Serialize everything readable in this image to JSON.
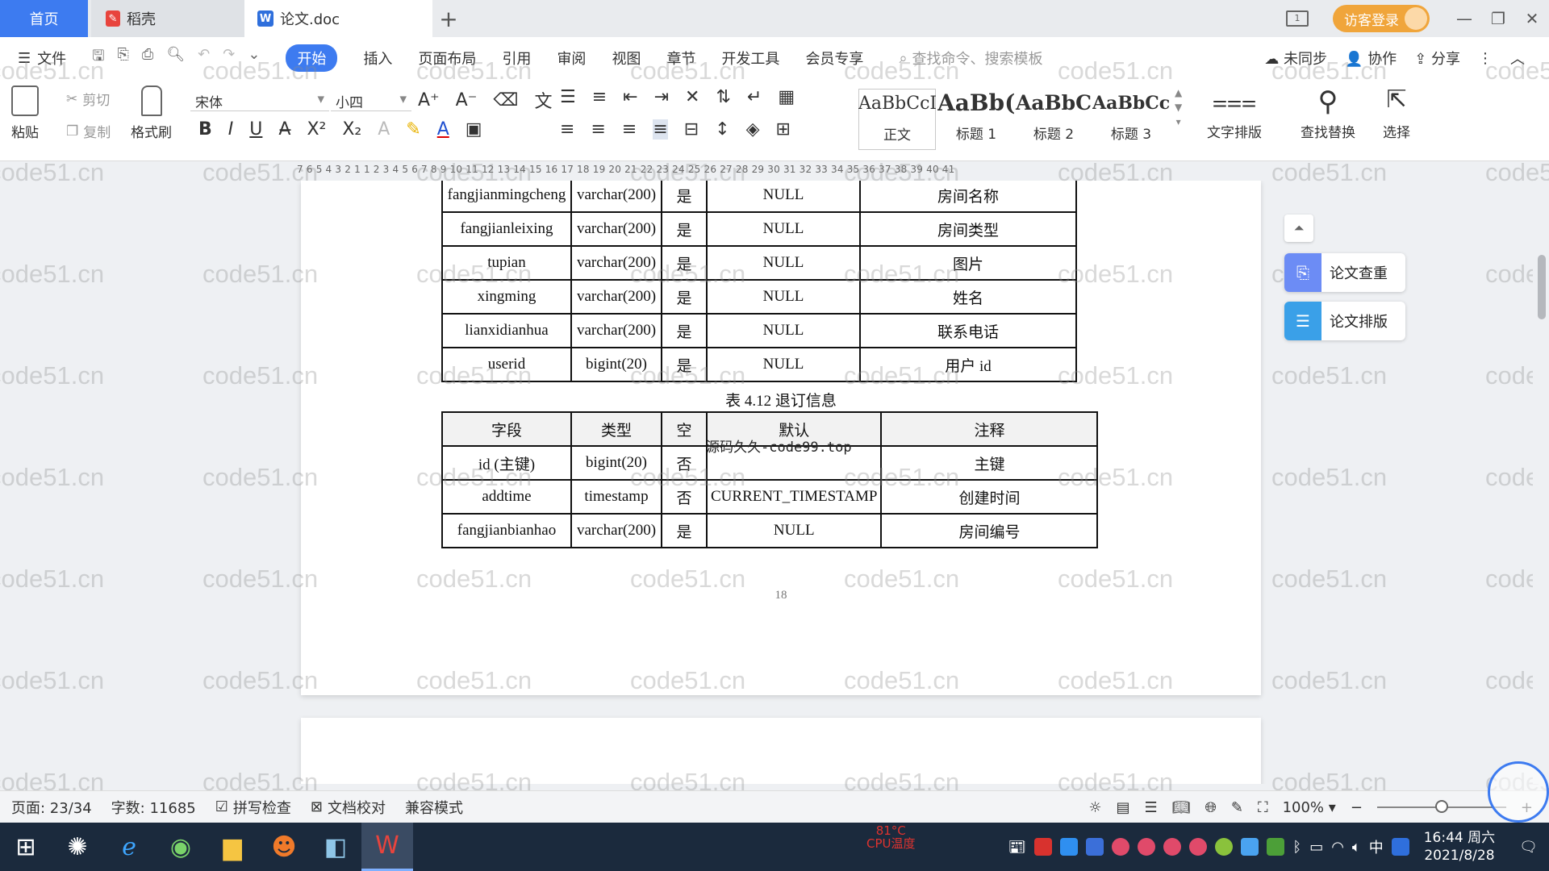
{
  "tabs": {
    "home": "首页",
    "daoke": "稻壳",
    "doc": "论文.doc",
    "add": "+"
  },
  "titlebar": {
    "visitor_login": "访客登录"
  },
  "menu": {
    "file": "文件",
    "items": [
      "开始",
      "插入",
      "页面布局",
      "引用",
      "审阅",
      "视图",
      "章节",
      "开发工具",
      "会员专享"
    ],
    "search_placeholder": "查找命令、搜索模板",
    "unsynced": "未同步",
    "collab": "协作",
    "share": "分享"
  },
  "ribbon": {
    "paste": "粘贴",
    "cut": "剪切",
    "copy": "复制",
    "format_painter": "格式刷",
    "font": "宋体",
    "size": "小四",
    "styles": [
      {
        "sample": "AaBbCcI",
        "name": "正文"
      },
      {
        "sample": "AaBb(",
        "name": "标题 1"
      },
      {
        "sample": "AaBbC",
        "name": "标题 2"
      },
      {
        "sample": "AaBbCcl",
        "name": "标题 3"
      }
    ],
    "text_layout": "文字排版",
    "find_replace": "查找替换",
    "select": "选择"
  },
  "ruler": "7 6 5 4 3 2 1   1 2 3 4 5 6 7 8 9 10 11 12 13 14 15 16 17 18 19 20 21 22 23 24 25 26 27 28 29 30 31 32 33 34 35 36 37 38 39 40 41",
  "table1": {
    "rows": [
      [
        "fangjianmingcheng",
        "varchar(200)",
        "是",
        "NULL",
        "房间名称"
      ],
      [
        "fangjianleixing",
        "varchar(200)",
        "是",
        "NULL",
        "房间类型"
      ],
      [
        "tupian",
        "varchar(200)",
        "是",
        "NULL",
        "图片"
      ],
      [
        "xingming",
        "varchar(200)",
        "是",
        "NULL",
        "姓名"
      ],
      [
        "lianxidianhua",
        "varchar(200)",
        "是",
        "NULL",
        "联系电话"
      ],
      [
        "userid",
        "bigint(20)",
        "是",
        "NULL",
        "用户 id"
      ]
    ]
  },
  "caption": "表 4.12  退订信息",
  "table2": {
    "header": [
      "字段",
      "类型",
      "空",
      "默认",
      "注释"
    ],
    "rows": [
      [
        "id (主键)",
        "bigint(20)",
        "否",
        "",
        "主键"
      ],
      [
        "addtime",
        "timestamp",
        "否",
        "CURRENT_TIMESTAMP",
        "创建时间"
      ],
      [
        "fangjianbianhao",
        "varchar(200)",
        "是",
        "NULL",
        "房间编号"
      ]
    ]
  },
  "overlay_text": "源码久久-code99.top",
  "page_number": "18",
  "watermark": "code51.cn",
  "side_panel": {
    "check": "论文查重",
    "layout": "论文排版"
  },
  "status": {
    "page": "页面: 23/34",
    "words": "字数: 11685",
    "spell": "拼写检查",
    "proof": "文档校对",
    "compat": "兼容模式",
    "zoom": "100%",
    "zoom_level": 0.5
  },
  "taskbar": {
    "cpu_label": "CPU温度",
    "cpu_value": "81°C",
    "ime": "中",
    "time": "16:44 周六",
    "date": "2021/8/28"
  }
}
